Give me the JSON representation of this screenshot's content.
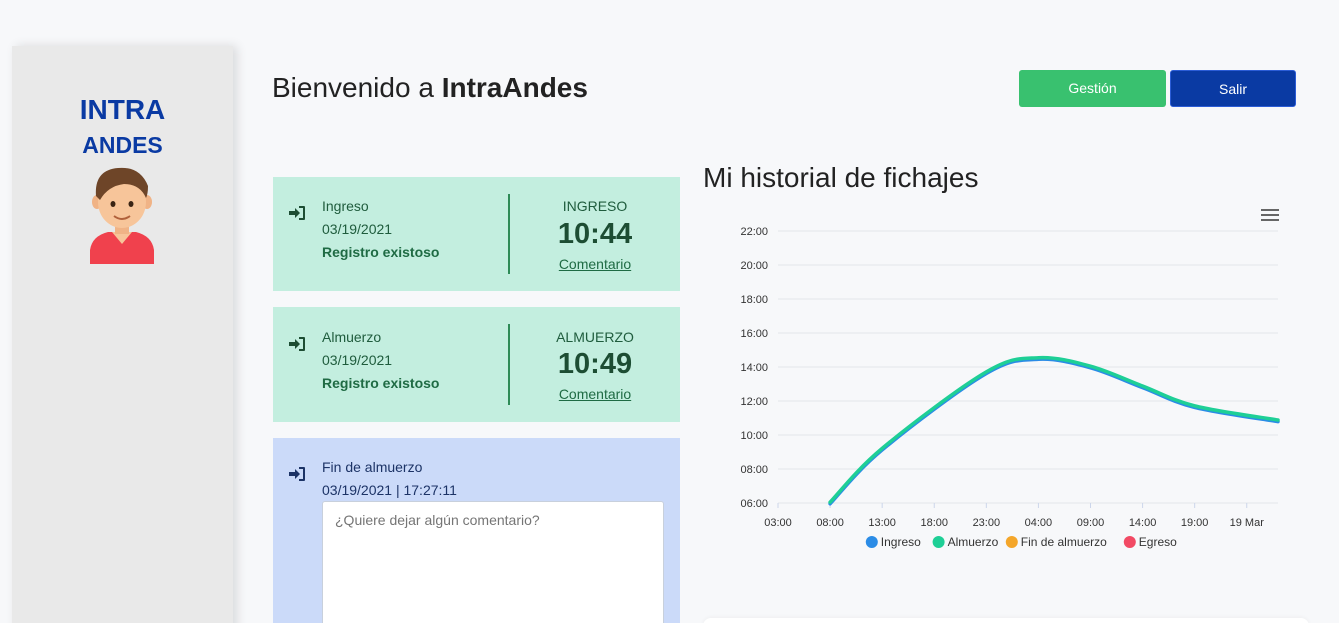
{
  "sidebar": {
    "logo_line1": "INTRA",
    "logo_line2": "ANDES",
    "avatar_icon": "user-avatar-icon"
  },
  "header": {
    "welcome_prefix": "Bienvenido a ",
    "welcome_brand": "IntraAndes",
    "gestion_label": "Gestión",
    "salir_label": "Salir"
  },
  "colors": {
    "green_button": "#39c16f",
    "blue_button": "#0a3aa3",
    "green_card": "#c3eedf",
    "blue_card": "#cbdaf9"
  },
  "cards": [
    {
      "icon": "sign-in-icon",
      "type": "Ingreso",
      "date": "03/19/2021",
      "status": "Registro existoso",
      "right_label": "INGRESO",
      "time": "10:44",
      "comment_link": "Comentario"
    },
    {
      "icon": "sign-in-icon",
      "type": "Almuerzo",
      "date": "03/19/2021",
      "status": "Registro existoso",
      "right_label": "ALMUERZO",
      "time": "10:49",
      "comment_link": "Comentario"
    },
    {
      "icon": "sign-in-icon",
      "type": "Fin de almuerzo",
      "datetime": "03/19/2021 | 17:27:11",
      "comment_placeholder": "¿Quiere dejar algún comentario?"
    }
  ],
  "chart_title": "Mi historial de fichajes",
  "chart_menu_icon": "hamburger-menu-icon",
  "chart_data": {
    "type": "line",
    "title": "",
    "xlabel": "",
    "ylabel": "",
    "x_ticks": [
      "03:00",
      "08:00",
      "13:00",
      "18:00",
      "23:00",
      "04:00",
      "09:00",
      "14:00",
      "19:00",
      "19 Mar"
    ],
    "y_ticks": [
      "06:00",
      "08:00",
      "10:00",
      "12:00",
      "14:00",
      "16:00",
      "18:00",
      "20:00",
      "22:00"
    ],
    "ylim": [
      "06:00",
      "22:00"
    ],
    "grid": true,
    "legend_position": "bottom",
    "series": [
      {
        "name": "Ingreso",
        "color": "#2b8ce6",
        "x": [
          "08:00",
          "13:00",
          "23:00",
          "04:00",
          "09:00",
          "14:00",
          "19:00",
          "19 Mar"
        ],
        "y": [
          "06:00",
          "09:10",
          "13:40",
          "14:30",
          "14:00",
          "12:50",
          "11:40",
          "10:50"
        ]
      },
      {
        "name": "Almuerzo",
        "color": "#1ecf96",
        "x": [
          "08:00",
          "13:00",
          "23:00",
          "04:00",
          "09:00",
          "14:00",
          "19:00",
          "19 Mar"
        ],
        "y": [
          "06:00",
          "09:10",
          "13:40",
          "14:30",
          "14:00",
          "12:50",
          "11:40",
          "10:50"
        ]
      },
      {
        "name": "Fin de almuerzo",
        "color": "#f4a62a",
        "x": [],
        "y": []
      },
      {
        "name": "Egreso",
        "color": "#f24a64",
        "x": [],
        "y": []
      }
    ]
  }
}
